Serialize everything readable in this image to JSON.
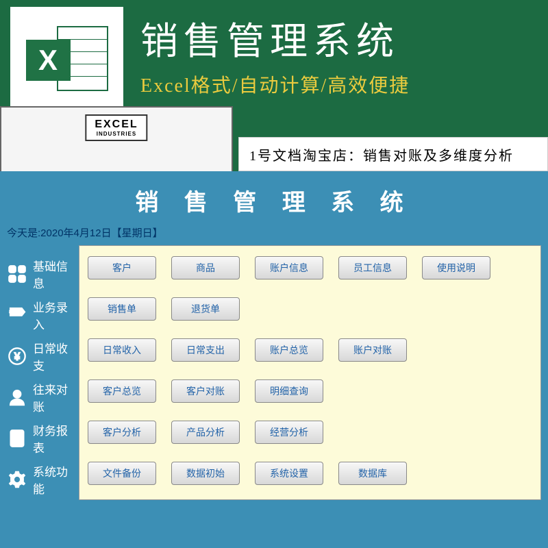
{
  "header": {
    "main_title": "销售管理系统",
    "sub_title": "Excel格式/自动计算/高效便捷",
    "building_sign": "EXCEL",
    "building_sign_small": "INDUSTRIES",
    "shop_label": "1号文档淘宝店：销售对账及多维度分析"
  },
  "app": {
    "title": "销 售 管 理 系 统",
    "date_line": "今天是:2020年4月12日【星期日】"
  },
  "sidebar": [
    {
      "icon": "grid",
      "label": "基础信息"
    },
    {
      "icon": "sale",
      "label": "业务录入"
    },
    {
      "icon": "yen",
      "label": "日常收支"
    },
    {
      "icon": "person",
      "label": "往来对账"
    },
    {
      "icon": "doc",
      "label": "财务报表"
    },
    {
      "icon": "gear",
      "label": "系统功能"
    }
  ],
  "rows": [
    [
      "客户",
      "商品",
      "账户信息",
      "员工信息",
      "使用说明"
    ],
    [
      "销售单",
      "退货单"
    ],
    [
      "日常收入",
      "日常支出",
      "账户总览",
      "账户对账"
    ],
    [
      "客户总览",
      "客户对账",
      "明细查询"
    ],
    [
      "客户分析",
      "产品分析",
      "经营分析"
    ],
    [
      "文件备份",
      "数据初始",
      "系统设置",
      "数据库"
    ]
  ]
}
